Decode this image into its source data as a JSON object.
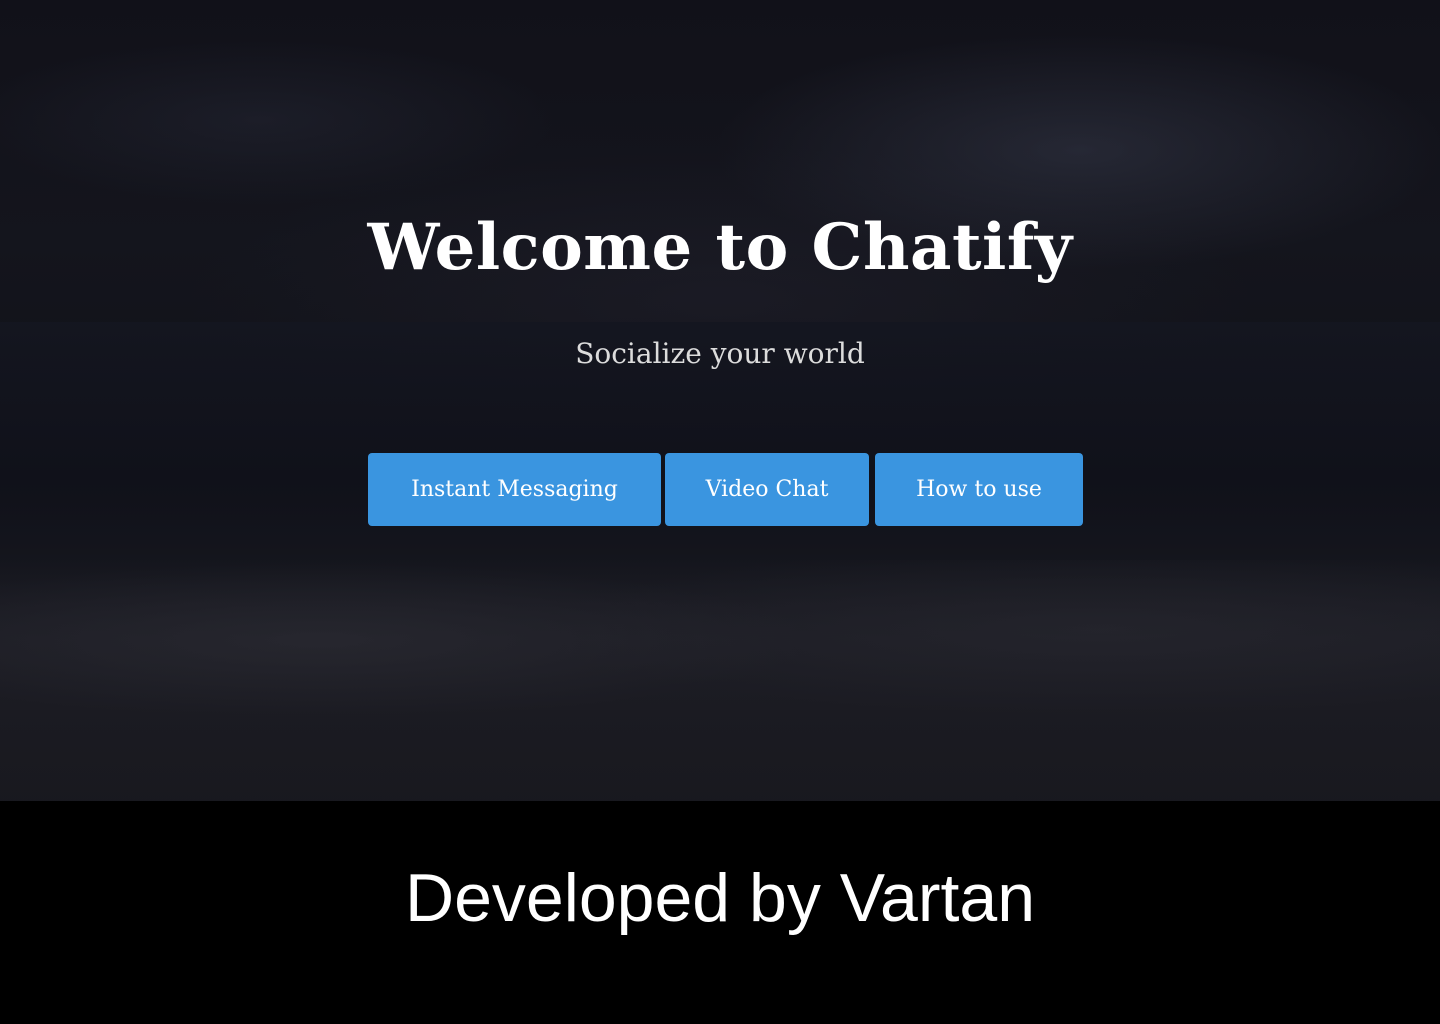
{
  "hero": {
    "title": "Welcome to Chatify",
    "subtitle": "Socialize your world",
    "buttons": [
      {
        "label": "Instant Messaging"
      },
      {
        "label": "Video Chat"
      },
      {
        "label": "How to use"
      }
    ]
  },
  "footer": {
    "caption": "Developed by Vartan"
  },
  "colors": {
    "accent": "#3a95e0",
    "background": "#12131a",
    "footer_background": "#000000",
    "text": "#ffffff"
  }
}
